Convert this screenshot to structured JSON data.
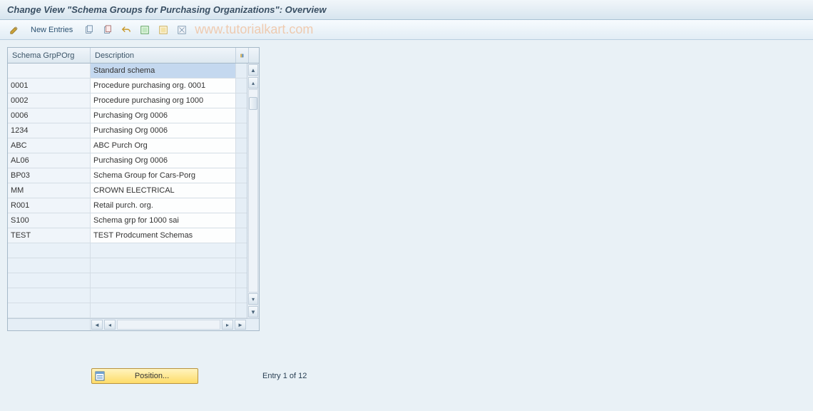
{
  "title": "Change View \"Schema Groups for Purchasing Organizations\": Overview",
  "toolbar": {
    "new_entries_label": "New Entries"
  },
  "watermark": "www.tutorialkart.com",
  "table": {
    "columns": {
      "schema": "Schema GrpPOrg",
      "description": "Description"
    },
    "rows": [
      {
        "schema": "",
        "description": "Standard schema",
        "selected": true
      },
      {
        "schema": "0001",
        "description": "Procedure purchasing org. 0001"
      },
      {
        "schema": "0002",
        "description": "Procedure purchasing org 1000"
      },
      {
        "schema": "0006",
        "description": "Purchasing Org 0006"
      },
      {
        "schema": "1234",
        "description": "Purchasing Org 0006"
      },
      {
        "schema": "ABC",
        "description": "ABC Purch Org"
      },
      {
        "schema": "AL06",
        "description": "Purchasing Org 0006"
      },
      {
        "schema": "BP03",
        "description": "Schema Group for Cars-Porg"
      },
      {
        "schema": "MM",
        "description": "CROWN ELECTRICAL"
      },
      {
        "schema": "R001",
        "description": "Retail purch. org."
      },
      {
        "schema": "S100",
        "description": "Schema grp for 1000 sai"
      },
      {
        "schema": "TEST",
        "description": "TEST Prodcument Schemas"
      }
    ],
    "empty_rows": 5
  },
  "footer": {
    "position_label": "Position...",
    "entry_info": "Entry 1 of 12"
  }
}
